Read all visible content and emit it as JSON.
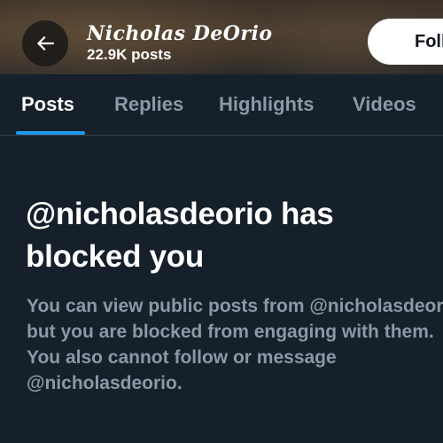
{
  "header": {
    "profile_name": "Nicholas DeOrio",
    "post_count": "22.9K posts",
    "follow_label": "Follow"
  },
  "tabs": [
    {
      "label": "Posts",
      "active": true
    },
    {
      "label": "Replies",
      "active": false
    },
    {
      "label": "Highlights",
      "active": false
    },
    {
      "label": "Videos",
      "active": false
    }
  ],
  "blocked": {
    "title": "@nicholasdeorio has blocked you",
    "body_lines": [
      "You can view public posts from @nicholasdeorio,",
      "but you are blocked from engaging with them.",
      "You also cannot follow or message",
      "@nicholasdeorio."
    ]
  },
  "colors": {
    "background": "#15202b",
    "accent": "#1d9bf0",
    "secondary_text": "#8b98a5"
  },
  "icons": {
    "back": "arrow-left-icon"
  }
}
